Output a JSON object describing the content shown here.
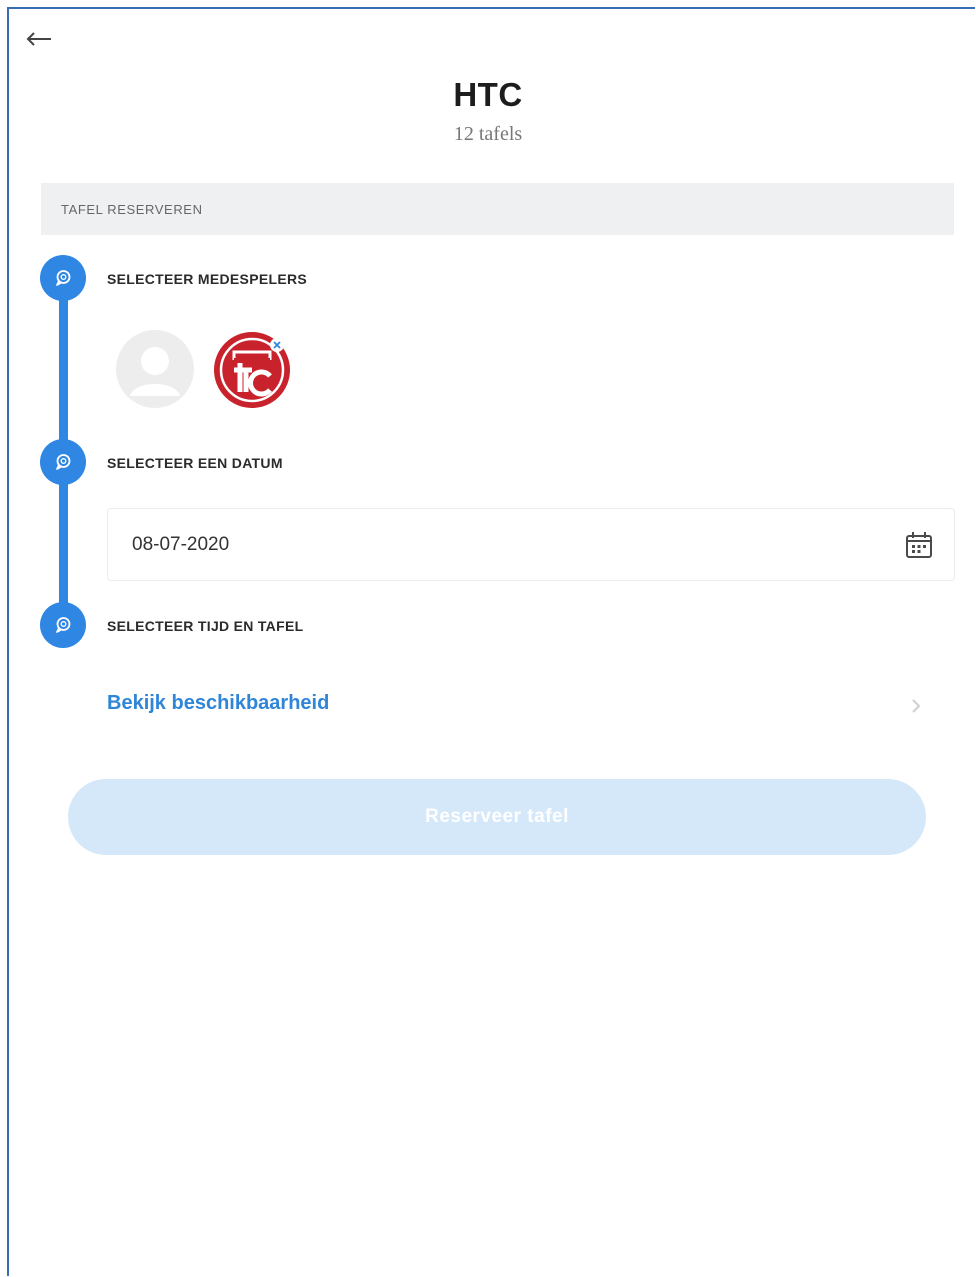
{
  "header": {
    "back_icon": "arrow-left-icon",
    "title": "HTC",
    "subtitle": "12 tafels"
  },
  "section": {
    "title": "TAFEL RESERVEREN"
  },
  "steps": [
    {
      "label": "SELECTEER MEDESPELERS",
      "icon": "search-bubble-icon"
    },
    {
      "label": "SELECTEER EEN DATUM",
      "icon": "search-bubble-icon"
    },
    {
      "label": "SELECTEER TIJD EN TAFEL",
      "icon": "search-bubble-icon"
    }
  ],
  "players": [
    {
      "type": "placeholder-avatar"
    },
    {
      "type": "club-logo",
      "logo_text": "HTC",
      "removable": true
    }
  ],
  "date": {
    "value": "08-07-2020",
    "icon": "calendar-icon"
  },
  "availability": {
    "label": "Bekijk beschikbaarheid",
    "icon": "chevron-right-icon"
  },
  "reserve_button": {
    "label": "Reserveer tafel",
    "disabled": true
  },
  "colors": {
    "accent": "#2f86e3",
    "link": "#2f86d8",
    "section_bg": "#eef0f2",
    "button_disabled": "#d5e8fa",
    "logo_red": "#c8232c",
    "frame_border": "#3a6bb5"
  }
}
